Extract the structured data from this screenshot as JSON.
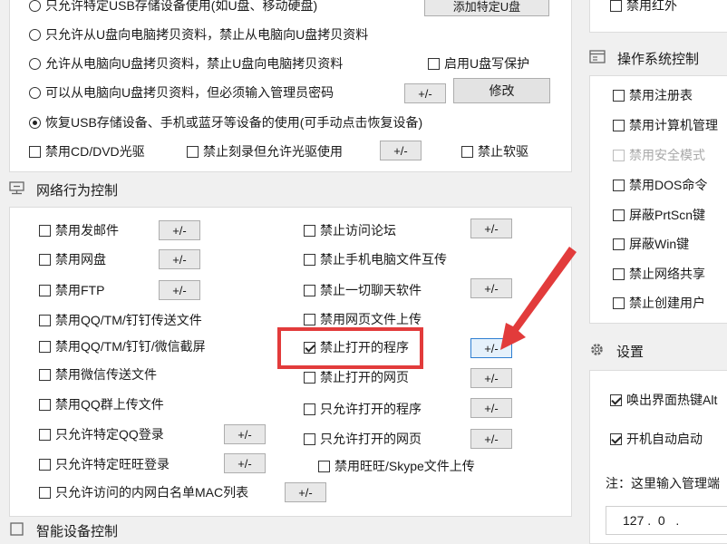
{
  "usb": {
    "opt1": "只允许特定USB存储设备使用(如U盘、移动硬盘)",
    "opt1_button": "添加特定U盘",
    "opt2": "只允许从U盘向电脑拷贝资料，禁止从电脑向U盘拷贝资料",
    "opt3": "允许从电脑向U盘拷贝资料，禁止U盘向电脑拷贝资料",
    "opt3_check": "启用U盘写保护",
    "opt4": "可以从电脑向U盘拷贝资料，但必须输入管理员密码",
    "opt4_pm": "+/-",
    "opt4_button": "修改",
    "opt5": "恢复USB存储设备、手机或蓝牙等设备的使用(可手动点击恢复设备)",
    "cd": "禁用CD/DVD光驱",
    "burn": "禁止刻录但允许光驱使用",
    "burn_pm": "+/-",
    "floppy": "禁止软驱"
  },
  "network": {
    "title": "网络行为控制",
    "left": [
      {
        "label": "禁用发邮件",
        "checked": false,
        "pm": "+/-"
      },
      {
        "label": "禁用网盘",
        "checked": false,
        "pm": "+/-"
      },
      {
        "label": "禁用FTP",
        "checked": false,
        "pm": "+/-"
      },
      {
        "label": "禁用QQ/TM/钉钉传送文件",
        "checked": false,
        "pm": ""
      },
      {
        "label": "禁用QQ/TM/钉钉/微信截屏",
        "checked": false,
        "pm": ""
      },
      {
        "label": "禁用微信传送文件",
        "checked": false,
        "pm": ""
      },
      {
        "label": "禁用QQ群上传文件",
        "checked": false,
        "pm": ""
      },
      {
        "label": "只允许特定QQ登录",
        "checked": false,
        "pm": "+/-"
      },
      {
        "label": "只允许特定旺旺登录",
        "checked": false,
        "pm": "+/-"
      },
      {
        "label": "只允许访问的内网白名单MAC列表",
        "checked": false,
        "pm": "+/-"
      }
    ],
    "right": [
      {
        "label": "禁止访问论坛",
        "checked": false,
        "pm": "+/-"
      },
      {
        "label": "禁止手机电脑文件互传",
        "checked": false,
        "pm": ""
      },
      {
        "label": "禁止一切聊天软件",
        "checked": false,
        "pm": "+/-"
      },
      {
        "label": "禁用网页文件上传",
        "checked": false,
        "pm": ""
      },
      {
        "label": "禁止打开的程序",
        "checked": true,
        "pm": "+/-"
      },
      {
        "label": "禁止打开的网页",
        "checked": false,
        "pm": "+/-"
      },
      {
        "label": "只允许打开的程序",
        "checked": false,
        "pm": "+/-"
      },
      {
        "label": "只允许打开的网页",
        "checked": false,
        "pm": "+/-"
      },
      {
        "label": "禁用旺旺/Skype文件上传",
        "checked": false,
        "pm": ""
      }
    ]
  },
  "smart_device_title": "智能设备控制",
  "sidebar": {
    "infrared": "禁用红外",
    "os_title": "操作系统控制",
    "os_items": [
      {
        "label": "禁用注册表",
        "disabled": false
      },
      {
        "label": "禁用计算机管理",
        "disabled": false
      },
      {
        "label": "禁用安全模式",
        "disabled": true
      },
      {
        "label": "禁用DOS命令",
        "disabled": false
      },
      {
        "label": "屏蔽PrtScn键",
        "disabled": false
      },
      {
        "label": "屏蔽Win键",
        "disabled": false
      },
      {
        "label": "禁止网络共享",
        "disabled": false
      },
      {
        "label": "禁止创建用户",
        "disabled": false
      }
    ],
    "settings_title": "设置",
    "hotkey": "唤出界面热键Alt",
    "autostart": "开机自动启动",
    "note": "注：这里输入管理端",
    "ip": "127 .  0   ."
  },
  "colors": {
    "highlight": "#e23b3b",
    "arrow": "#e23b3b",
    "focus": "#2f7fd2"
  }
}
